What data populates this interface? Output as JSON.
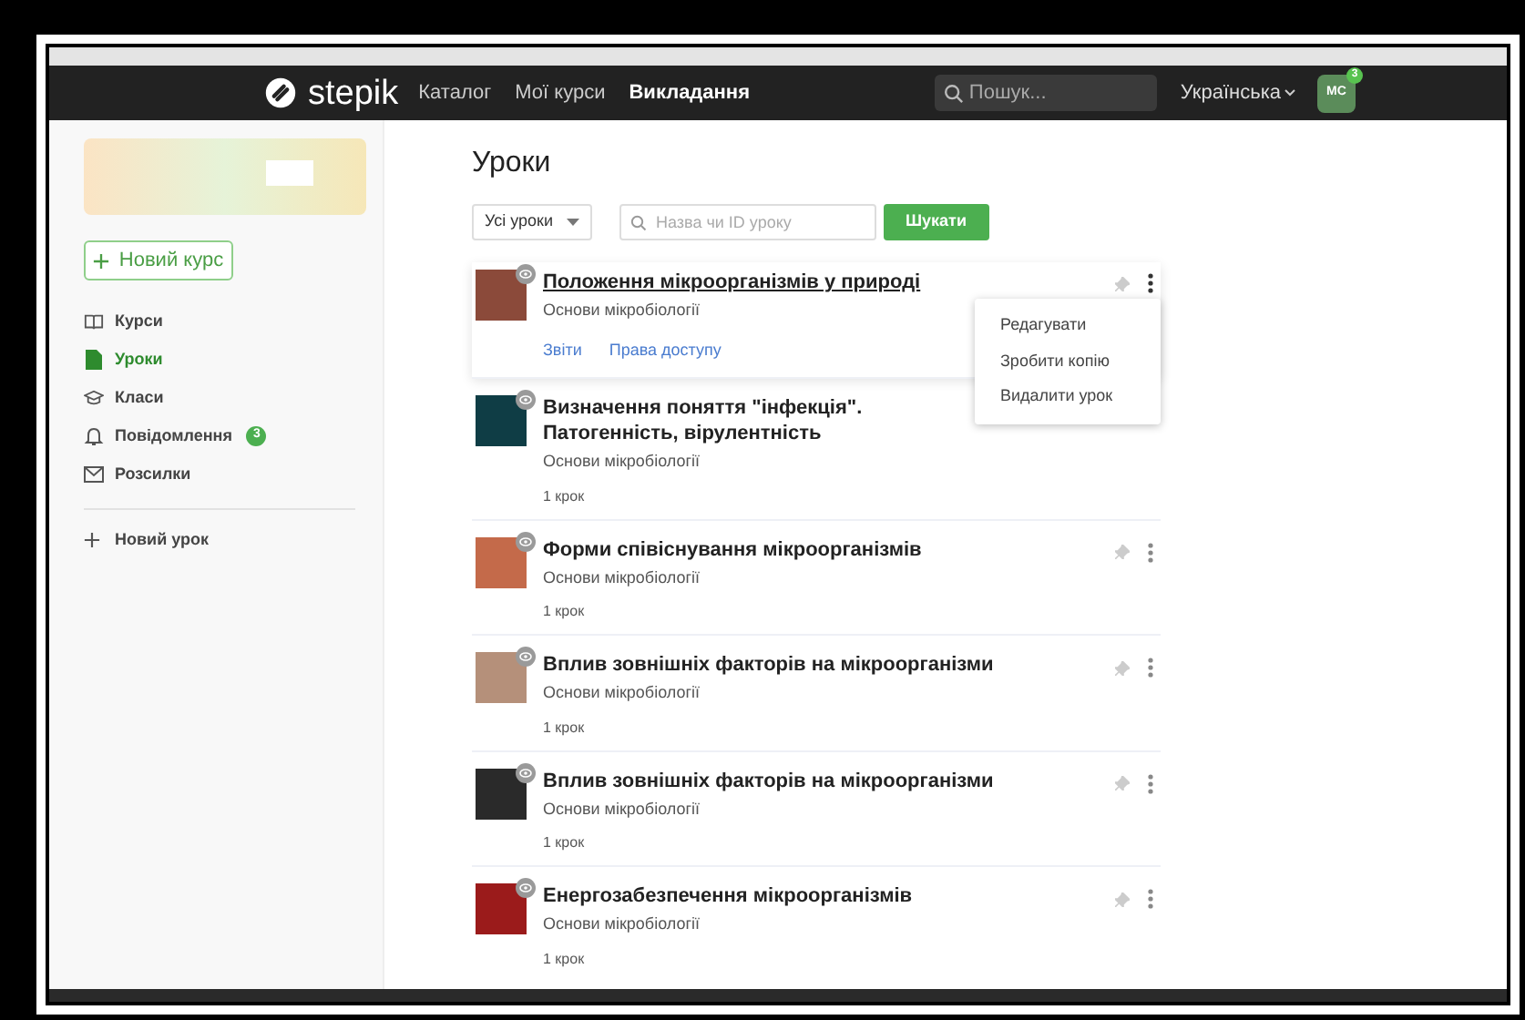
{
  "navbar": {
    "logo": "stepik",
    "links": [
      {
        "label": "Каталог",
        "selected": false
      },
      {
        "label": "Мої курси",
        "selected": false
      },
      {
        "label": "Викладання",
        "selected": true
      }
    ],
    "search": {
      "placeholder": "Пошук..."
    },
    "language": "Українська",
    "avatar": {
      "initials": "MC",
      "badge": "3"
    }
  },
  "sidebar": {
    "new_course": "Новий курс",
    "items": [
      {
        "kind": "book",
        "label": "Курси",
        "selected": false
      },
      {
        "kind": "lesson",
        "label": "Уроки",
        "selected": true
      },
      {
        "kind": "class",
        "label": "Класи",
        "selected": false
      },
      {
        "kind": "bell",
        "label": "Повідомлення",
        "selected": false,
        "badge": "3"
      },
      {
        "kind": "mail",
        "label": "Розсилки",
        "selected": false
      }
    ],
    "new_lesson": "Новий урок"
  },
  "main": {
    "title": "Уроки",
    "filter": "Усі уроки",
    "search": {
      "placeholder": "Назва чи ID уроку"
    },
    "search_button": "Шукати",
    "lessons": [
      {
        "title": "Положення мікроорганізмів у природі",
        "course": "Основи мікробіології",
        "links": [
          "Звіти",
          "Права доступу"
        ],
        "hovered": true,
        "menu": [
          "Редагувати",
          "Зробити копію",
          "Видалити урок"
        ]
      },
      {
        "title": "Визначення поняття \"інфекція\". Патогенність, вірулентність",
        "course": "Основи мікробіології",
        "steps": "1 крок",
        "hovered": false
      },
      {
        "title": "Форми співіснування мікроорганізмів",
        "course": "Основи мікробіології",
        "steps": "1 крок",
        "hovered": false
      },
      {
        "title": "Вплив зовнішніх факторів на мікроорганізми",
        "course": "Основи мікробіології",
        "steps": "1 крок",
        "hovered": false
      },
      {
        "title": "Вплив зовнішніх факторів на мікроорганізми",
        "course": "Основи мікробіології",
        "steps": "1 крок",
        "hovered": false
      },
      {
        "title": "Енергозабезпечення мікроорганізмів",
        "course": "Основи мікробіології",
        "steps": "1 крок",
        "hovered": false
      }
    ]
  }
}
